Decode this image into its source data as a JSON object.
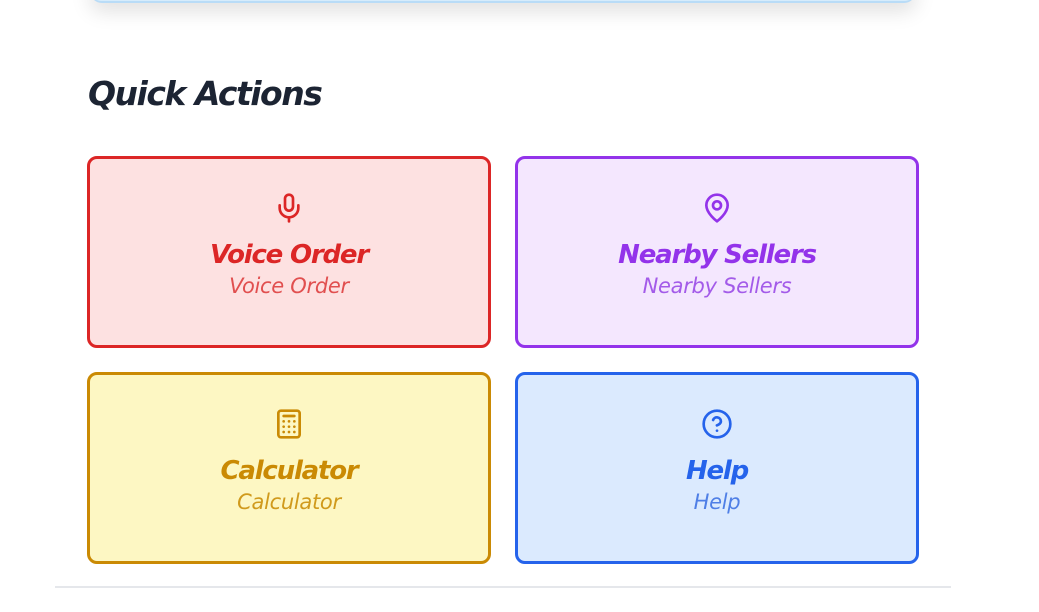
{
  "quick_actions": {
    "title": "Quick Actions",
    "items": [
      {
        "label": "Voice Order",
        "sublabel": "Voice Order",
        "icon": "microphone-icon",
        "color": "#dc2626",
        "background": "#fde1e1"
      },
      {
        "label": "Nearby Sellers",
        "sublabel": "Nearby Sellers",
        "icon": "map-pin-icon",
        "color": "#9333ea",
        "background": "#f4e7fe"
      },
      {
        "label": "Calculator",
        "sublabel": "Calculator",
        "icon": "calculator-icon",
        "color": "#ca8a04",
        "background": "#fdf7c3"
      },
      {
        "label": "Help",
        "sublabel": "Help",
        "icon": "help-circle-icon",
        "color": "#2563eb",
        "background": "#dbeafe"
      }
    ]
  }
}
